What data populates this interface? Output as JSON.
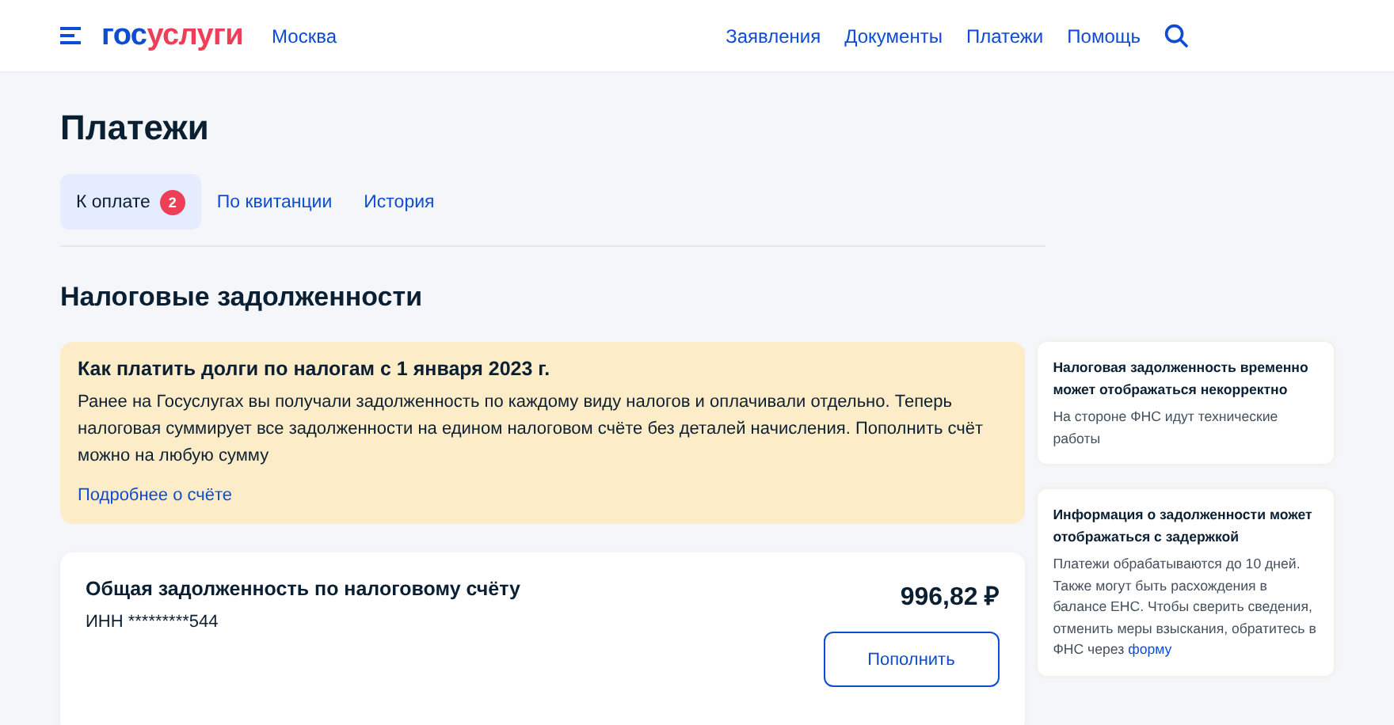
{
  "header": {
    "logo_primary": "гос",
    "logo_accent": "услуги",
    "city": "Москва",
    "nav": [
      {
        "label": "Заявления"
      },
      {
        "label": "Документы"
      },
      {
        "label": "Платежи"
      },
      {
        "label": "Помощь"
      }
    ]
  },
  "page_title": "Платежи",
  "tabs": [
    {
      "label": "К оплате",
      "badge": "2",
      "selected": true
    },
    {
      "label": "По квитанции",
      "selected": false
    },
    {
      "label": "История",
      "selected": false
    }
  ],
  "section_title": "Налоговые задолженности",
  "notice": {
    "title": "Как платить долги по налогам с 1 января 2023 г.",
    "text": "Ранее на Госуслугах вы получали задолженность по каждому виду налогов и оплачивали отдельно. Теперь налоговая суммирует все задолженности на едином налоговом счёте без деталей начисления. Пополнить счёт можно на любую сумму",
    "link": "Подробнее о счёте"
  },
  "debt": {
    "title": "Общая задолженность по налоговому счёту",
    "inn": "ИНН *********544",
    "amount": "996,82 ₽",
    "button": "Пополнить"
  },
  "side_notes": [
    {
      "title": "Налоговая задолженность временно может отображаться некорректно",
      "text": "На стороне ФНС идут технические работы"
    },
    {
      "title": "Информация о задолженности может отображаться с задержкой",
      "text": "Платежи обрабатываются до 10 дней. Также могут быть расхождения в балансе ЕНС. Чтобы сверить сведения, отменить меры взыскания, обратитесь в ФНС через",
      "link": "форму"
    }
  ]
}
